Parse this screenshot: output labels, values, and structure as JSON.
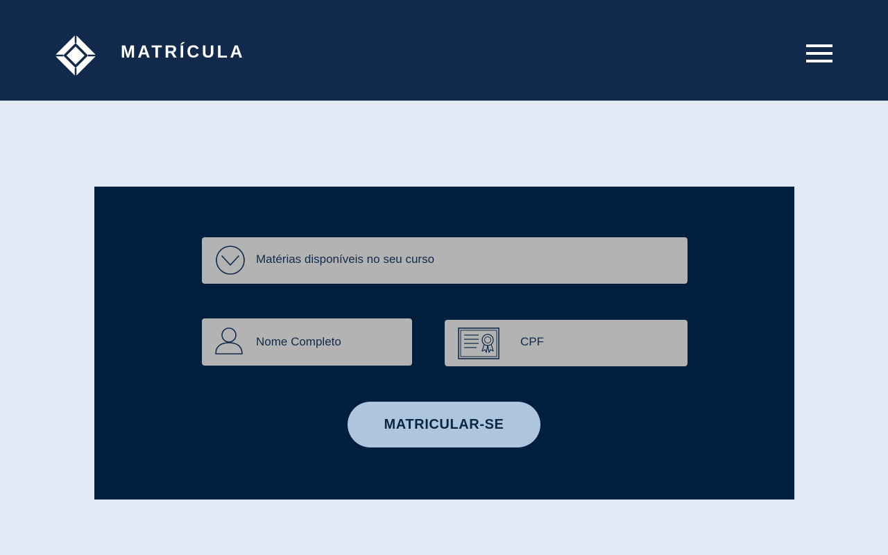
{
  "header": {
    "brand": "MATRÍCULA",
    "logo_icon": "diamond-logo-icon",
    "menu_icon": "hamburger-menu-icon"
  },
  "form": {
    "subjects": {
      "label": "Matérias disponíveis no seu curso",
      "icon": "chevron-down-circle-icon"
    },
    "full_name": {
      "label": "Nome Completo",
      "icon": "user-icon"
    },
    "cpf": {
      "label": "CPF",
      "icon": "certificate-icon"
    },
    "submit_label": "MATRICULAR-SE"
  },
  "colors": {
    "header_bg": "#112a4b",
    "page_bg": "#e1eaf4",
    "panel_bg": "#001e3d",
    "field_bg": "#b3b3b3",
    "button_bg": "#adc5dd",
    "text_dark": "#13294a"
  }
}
